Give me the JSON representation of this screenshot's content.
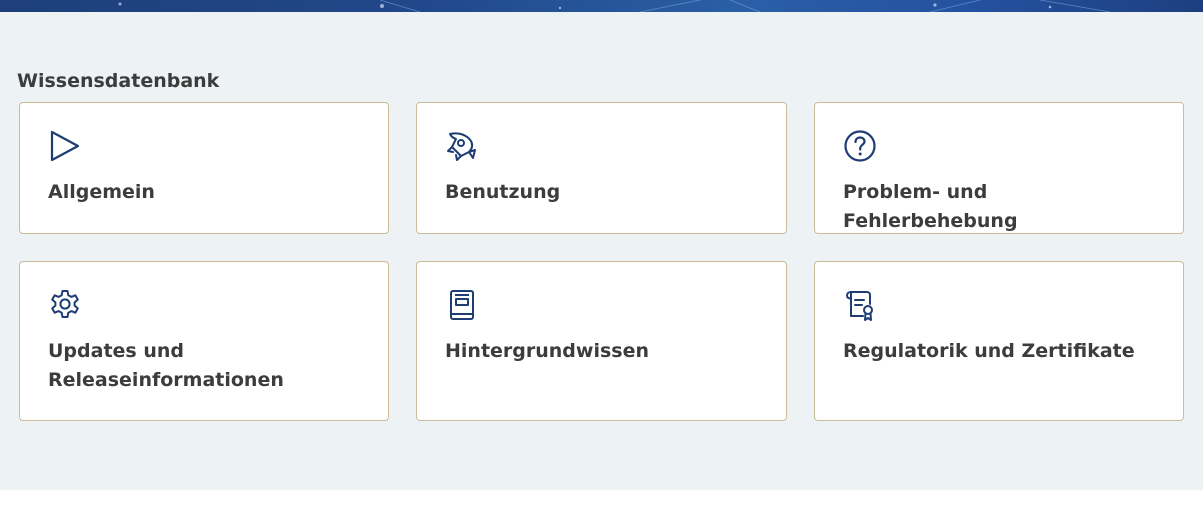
{
  "section": {
    "title": "Wissensdatenbank"
  },
  "colors": {
    "icon": "#1d3d73",
    "card_border": "#cdbb9b",
    "background": "#edf2f5",
    "text": "#3c3c3c"
  },
  "cards": [
    {
      "label": "Allgemein",
      "icon": "play-icon"
    },
    {
      "label": "Benutzung",
      "icon": "rocket-icon"
    },
    {
      "label": "Problem- und Fehlerbehebung",
      "icon": "question-circle-icon"
    },
    {
      "label": "Updates und Releaseinformationen",
      "icon": "gear-icon"
    },
    {
      "label": "Hintergrundwissen",
      "icon": "book-icon"
    },
    {
      "label": "Regulatorik und Zertifikate",
      "icon": "certificate-icon"
    }
  ]
}
